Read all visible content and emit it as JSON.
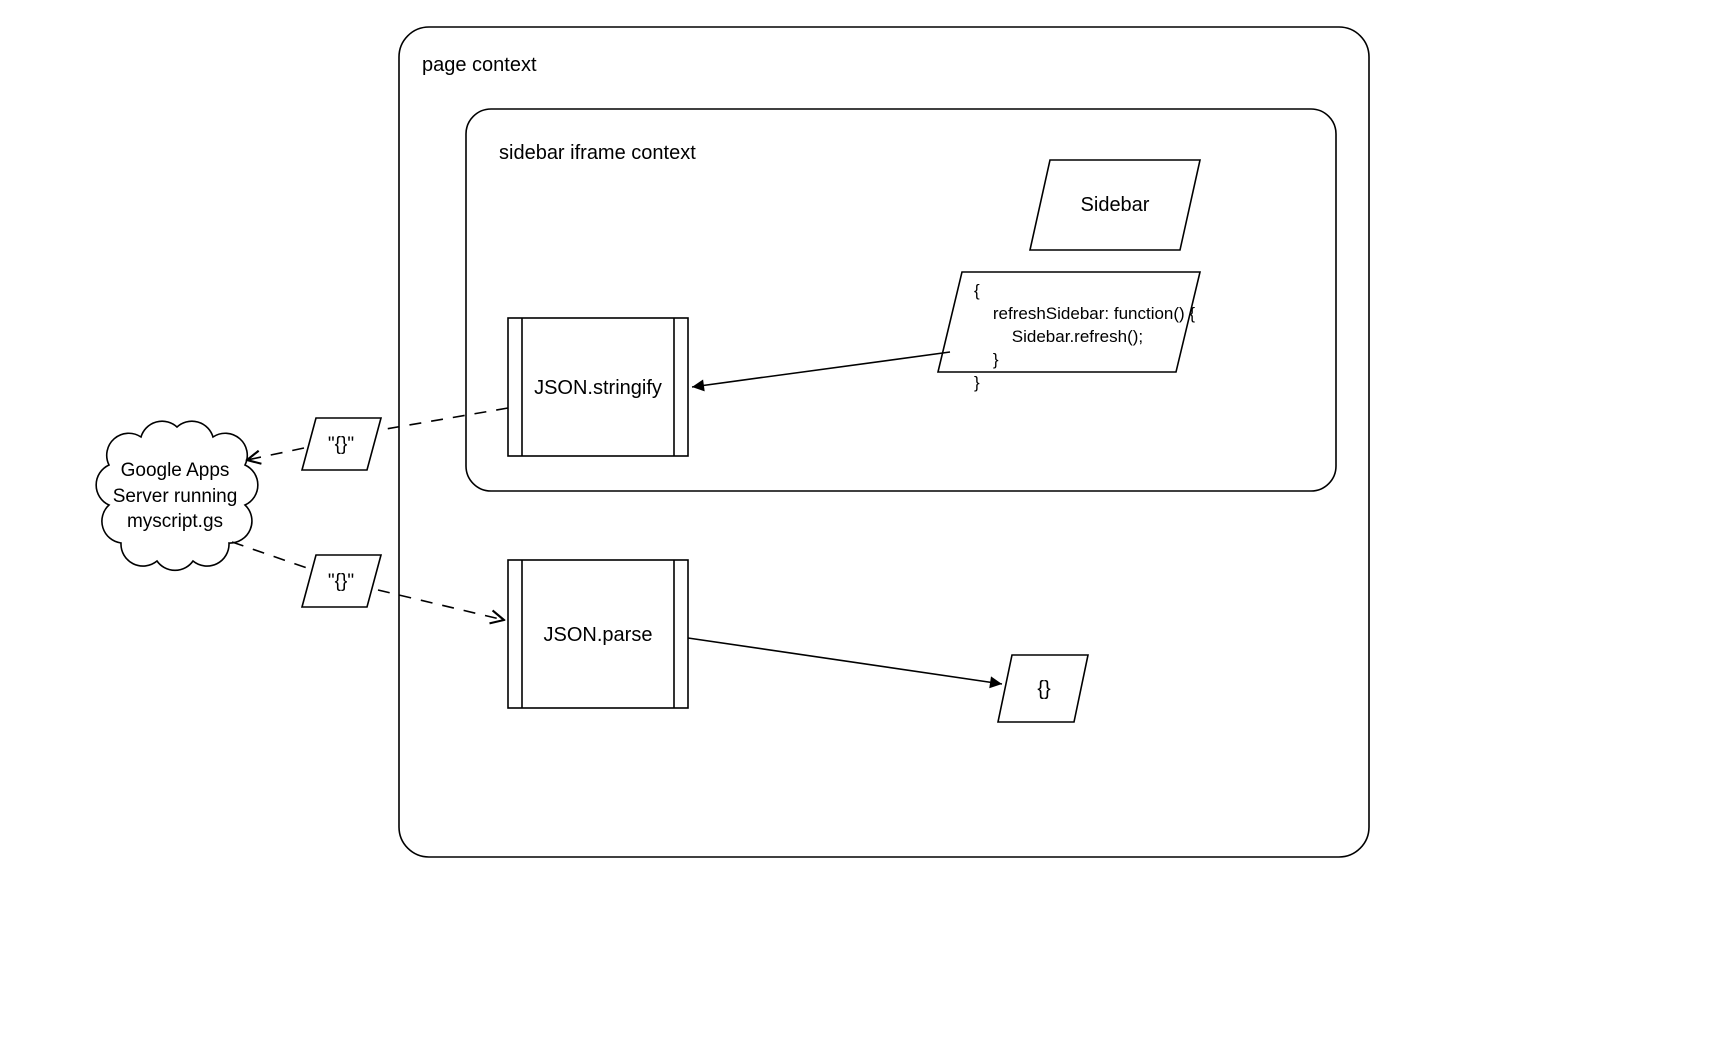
{
  "nodes": {
    "page_context": {
      "label": "page context"
    },
    "iframe_context": {
      "label": "sidebar iframe context"
    },
    "sidebar": {
      "label": "Sidebar"
    },
    "code_block": {
      "text": "{\n    refreshSidebar: function() {\n        Sidebar.refresh();\n    }\n}"
    },
    "json_stringify": {
      "label": "JSON.stringify"
    },
    "json_parse": {
      "label": "JSON.parse"
    },
    "cloud": {
      "text": "Google Apps\nServer running\nmyscript.gs"
    },
    "payload_top": {
      "label": "\"{}\""
    },
    "payload_bottom": {
      "label": "\"{}\""
    },
    "result_obj": {
      "label": "{}"
    }
  }
}
